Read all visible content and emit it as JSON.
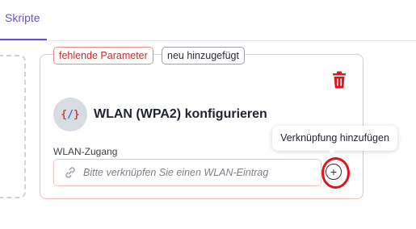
{
  "tabs": {
    "active": "Skripte"
  },
  "card": {
    "badges": {
      "missing_params": "fehlende Parameter",
      "newly_added": "neu hinzugefügt"
    },
    "title": "WLAN (WPA2) konfigurieren",
    "avatar_glyph_left": "{",
    "avatar_glyph_mid": "/",
    "avatar_glyph_right": "}",
    "field": {
      "label": "WLAN-Zugang",
      "placeholder": "Bitte verknüpfen Sie einen WLAN-Eintrag"
    },
    "add_link_tooltip": "Verknüpfung hinzufügen",
    "add_link_symbol": "+"
  },
  "icons": {
    "delete": "trash-icon",
    "link": "link-icon",
    "add": "plus-circle-icon"
  },
  "colors": {
    "accent": "#6b50c8",
    "danger": "#e0141c",
    "badge_missing": "#c0302a"
  }
}
